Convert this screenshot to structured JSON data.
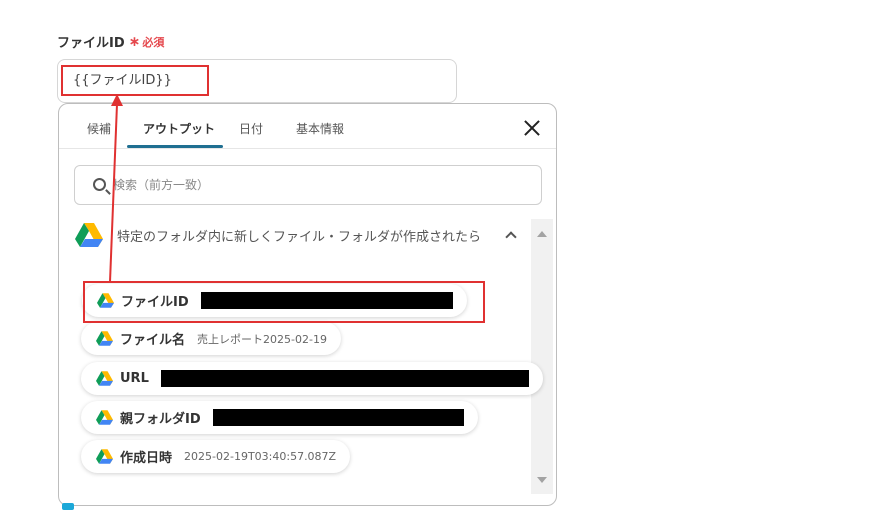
{
  "field": {
    "label": "ファイルID",
    "required_mark": "∗",
    "required_text": "必須",
    "value": "{{ファイルID}}"
  },
  "popup": {
    "tabs": [
      {
        "label": "候補"
      },
      {
        "label": "アウトプット"
      },
      {
        "label": "日付"
      },
      {
        "label": "基本情報"
      }
    ],
    "active_tab": "アウトプット",
    "search_placeholder": "検索（前方一致）",
    "group_title": "特定のフォルダ内に新しくファイル・フォルダが作成されたら",
    "items": [
      {
        "name": "ファイルID",
        "value": "",
        "redacted": true
      },
      {
        "name": "ファイル名",
        "value": "売上レポート2025-02-19",
        "redacted": false
      },
      {
        "name": "URL",
        "value": "",
        "redacted": true
      },
      {
        "name": "親フォルダID",
        "value": "",
        "redacted": true
      },
      {
        "name": "作成日時",
        "value": "2025-02-19T03:40:57.087Z",
        "redacted": false
      }
    ]
  },
  "colors": {
    "accent": "#1f6f91",
    "required": "#e5484d",
    "highlight": "#e03131"
  },
  "icons": {
    "drive": "google-drive-icon",
    "search": "search-icon",
    "close": "close-icon",
    "collapse": "chevron-up-icon"
  }
}
